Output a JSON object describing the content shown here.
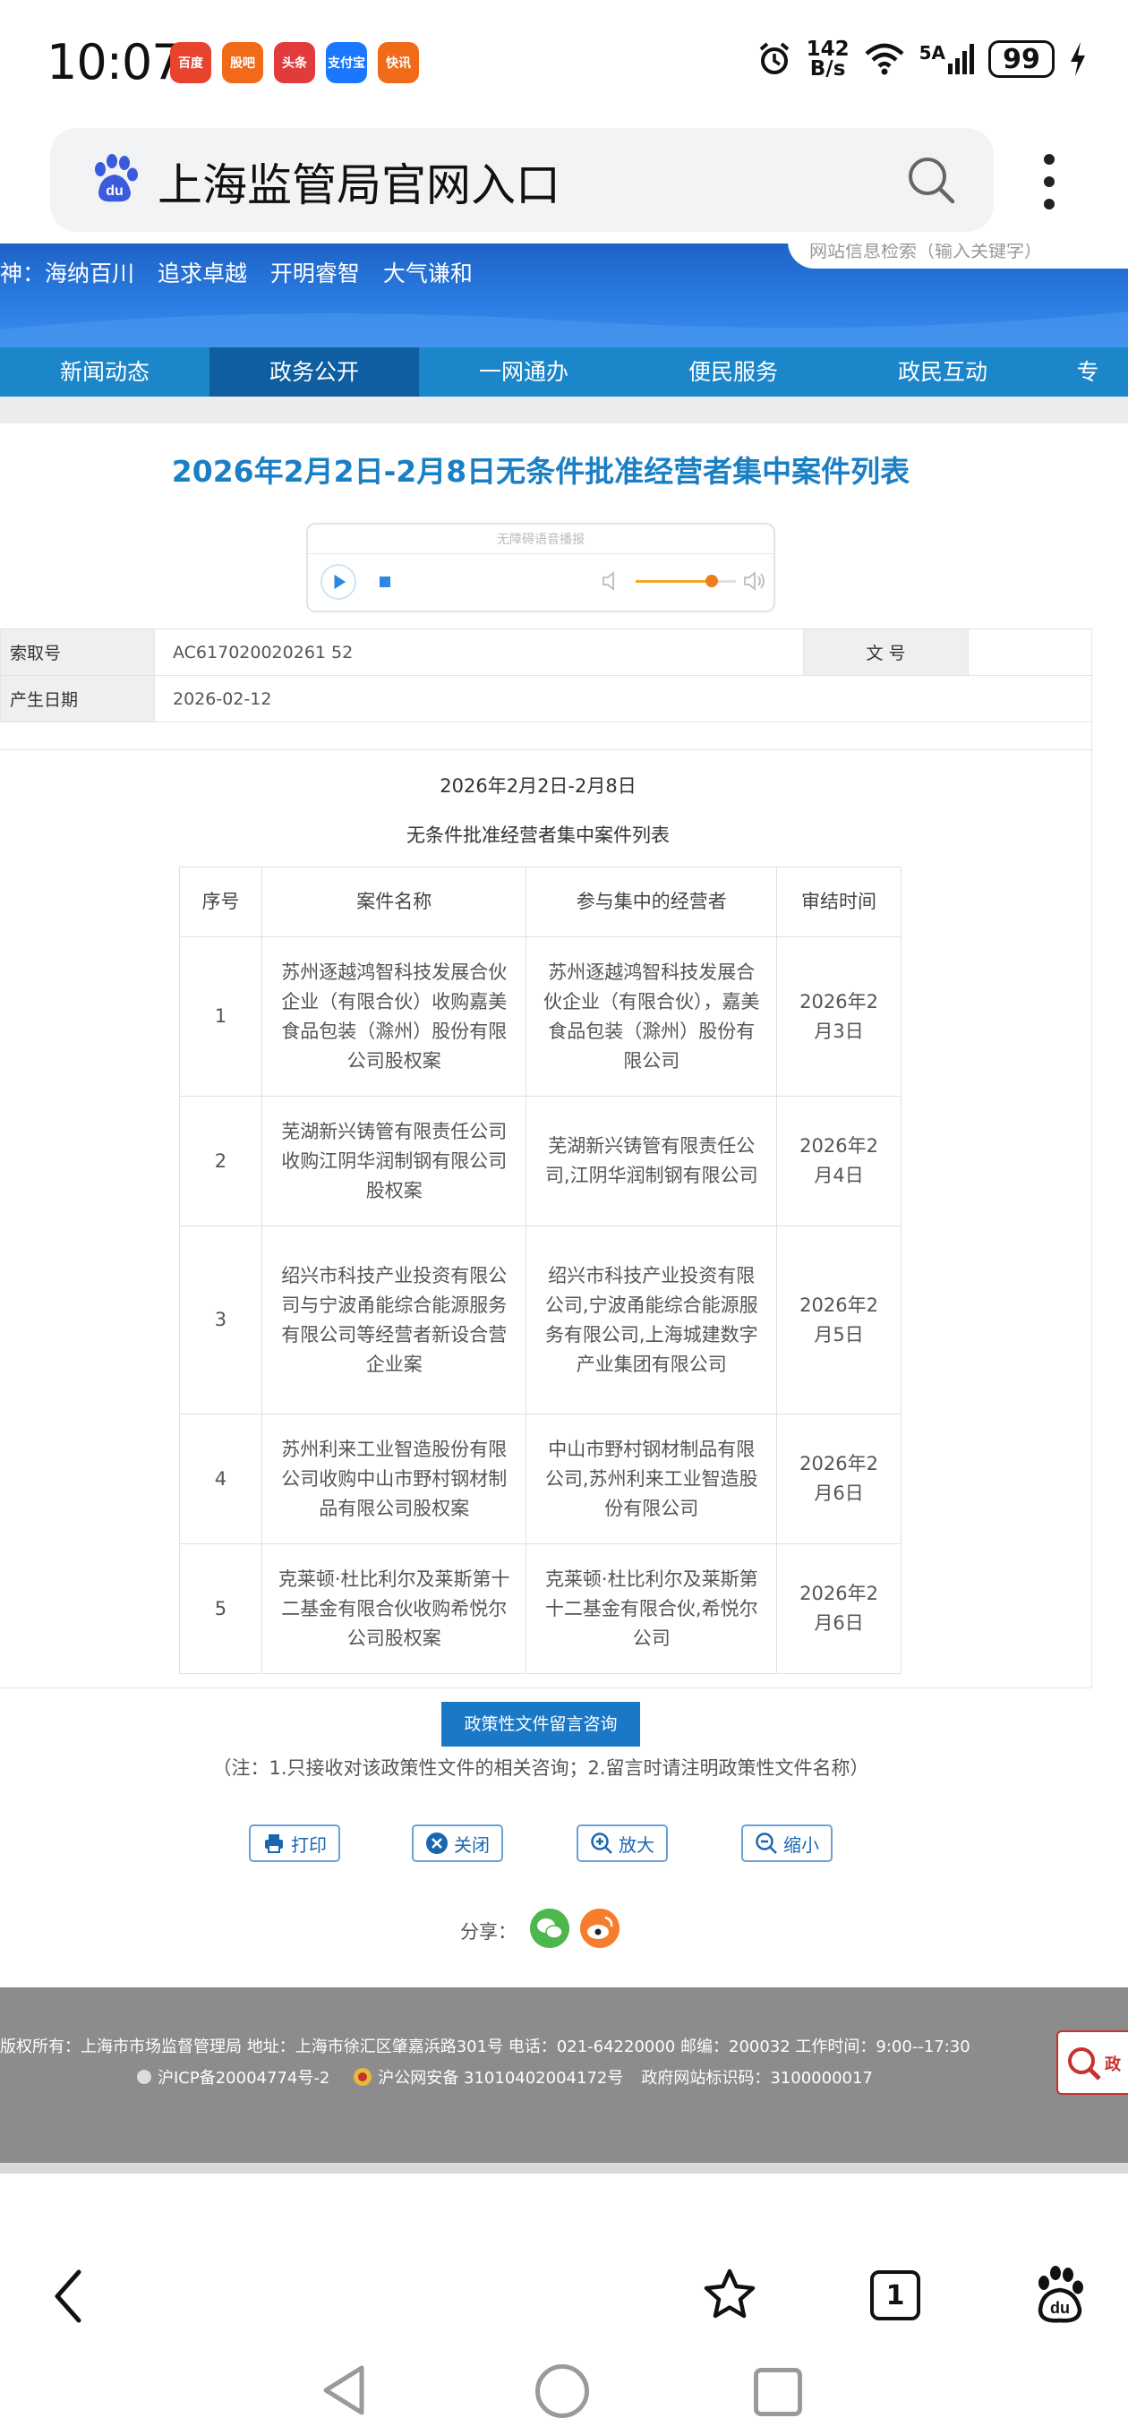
{
  "status_bar": {
    "time": "10:07",
    "app_icons": [
      "百度",
      "股吧",
      "头条",
      "支付宝",
      "快讯"
    ],
    "net_speed_value": "142",
    "net_speed_unit": "B/s",
    "network": "5A",
    "battery": "99"
  },
  "browser": {
    "search_text": "上海监管局官网入口",
    "tab_count": "1"
  },
  "banner": {
    "slogan": "神：海纳百川  追求卓越  开明睿智  大气谦和",
    "search_placeholder": "网站信息检索（输入关键字）"
  },
  "nav": {
    "items": [
      "新闻动态",
      "政务公开",
      "一网通办",
      "便民服务",
      "政民互动",
      "专"
    ],
    "active_index": 1
  },
  "page": {
    "title": "2026年2月2日-2月8日无条件批准经营者集中案件列表",
    "audio_label": "无障碍语音播报"
  },
  "meta": {
    "index_label": "索取号",
    "index_value": "AC617020020261 52",
    "doc_no_label": "文  号",
    "doc_no_value": "",
    "date_label": "产生日期",
    "date_value": "2026-02-12"
  },
  "doc": {
    "date_line": "2026年2月2日-2月8日",
    "subtitle": "无条件批准经营者集中案件列表",
    "headers": [
      "序号",
      "案件名称",
      "参与集中的经营者",
      "审结时间"
    ],
    "rows": [
      {
        "no": "1",
        "name": "苏州逐越鸿智科技发展合伙企业（有限合伙）收购嘉美食品包装（滁州）股份有限公司股权案",
        "parties": "苏州逐越鸿智科技发展合伙企业（有限合伙），嘉美食品包装（滁州）股份有限公司",
        "date": "2026年2月3日"
      },
      {
        "no": "2",
        "name": "芜湖新兴铸管有限责任公司收购江阴华润制钢有限公司股权案",
        "parties": "芜湖新兴铸管有限责任公司,江阴华润制钢有限公司",
        "date": "2026年2月4日"
      },
      {
        "no": "3",
        "name": "绍兴市科技产业投资有限公司与宁波甬能综合能源服务有限公司等经营者新设合营企业案",
        "parties": "绍兴市科技产业投资有限公司,宁波甬能综合能源服务有限公司,上海城建数字产业集团有限公司",
        "date": "2026年2月5日"
      },
      {
        "no": "4",
        "name": "苏州利来工业智造股份有限公司收购中山市野村钢材制品有限公司股权案",
        "parties": "中山市野村钢材制品有限公司,苏州利来工业智造股份有限公司",
        "date": "2026年2月6日"
      },
      {
        "no": "5",
        "name": "克莱顿·杜比利尔及莱斯第十二基金有限合伙收购希悦尔公司股权案",
        "parties": "克莱顿·杜比利尔及莱斯第十二基金有限合伙,希悦尔公司",
        "date": "2026年2月6日"
      }
    ]
  },
  "actions": {
    "consult_label": "政策性文件留言咨询",
    "consult_note": "（注：1.只接收对该政策性文件的相关咨询；2.留言时请注明政策性文件名称）",
    "print": "打印",
    "close": "关闭",
    "zoom_in": "放大",
    "zoom_out": "缩小",
    "share_label": "分享："
  },
  "footer": {
    "line1": "版权所有：上海市市场监督管理局 地址：上海市徐汇区肇嘉浜路301号 电话：021-64220000 邮编：200032 工作时间：9:00--17:30",
    "icp": "沪ICP备20004774号-2",
    "police": "沪公网安备 31010402004172号",
    "site_code": "政府网站标识码：3100000017",
    "badge": "政"
  },
  "colors": {
    "nav_blue": "#1b86c9",
    "nav_active": "#0f5ea1",
    "title_blue": "#1a7fc4",
    "footer_gray": "#8c8c8c"
  }
}
